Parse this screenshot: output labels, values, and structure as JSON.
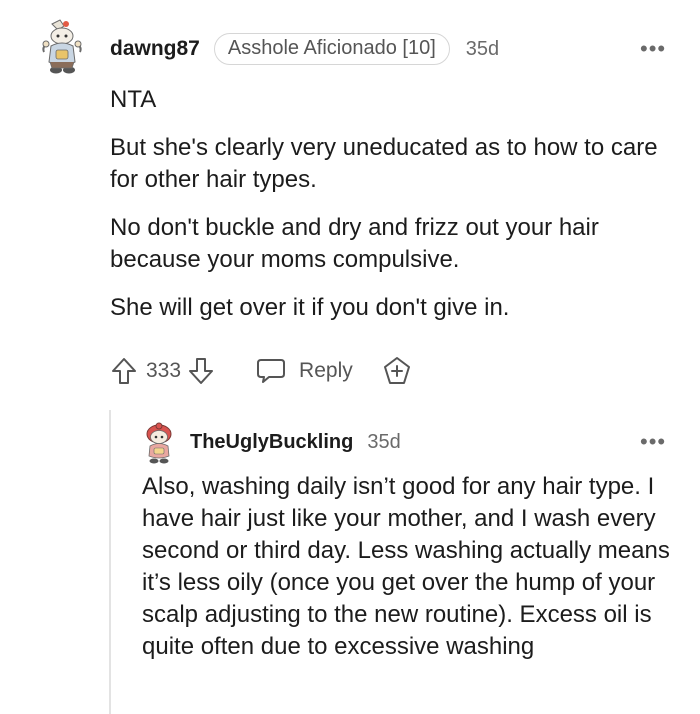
{
  "comment": {
    "username": "dawng87",
    "flair": "Asshole Aficionado [10]",
    "time": "35d",
    "more": "•••",
    "paragraphs": [
      "NTA",
      "But she's clearly very uneducated as to how to care for other hair types.",
      "No don't buckle and dry and frizz out your hair because your moms compulsive.",
      "She will get over it if you don't give in."
    ],
    "votes": "333",
    "reply_label": "Reply",
    "icons": {
      "avatar": "snoo-avatar",
      "upvote": "upvote-arrow-icon",
      "downvote": "downvote-arrow-icon",
      "reply": "speech-bubble-icon",
      "award": "award-plus-icon",
      "more": "more-dots-icon"
    }
  },
  "reply": {
    "username": "TheUglyBuckling",
    "time": "35d",
    "more": "•••",
    "text": "Also, washing daily isn’t good for any hair type. I have hair just like your mother, and I wash every second or third day. Less washing actually means it’s less oily (once you get over the hump of your scalp adjusting to the new routine). Excess oil is quite often due to excessive washing"
  },
  "colors": {
    "text": "#1c1c1c",
    "meta": "#6a6a6a",
    "flair_border": "#d6d6d6",
    "thread_line": "#e3e3e3",
    "avatar_red": "#d9534f"
  }
}
